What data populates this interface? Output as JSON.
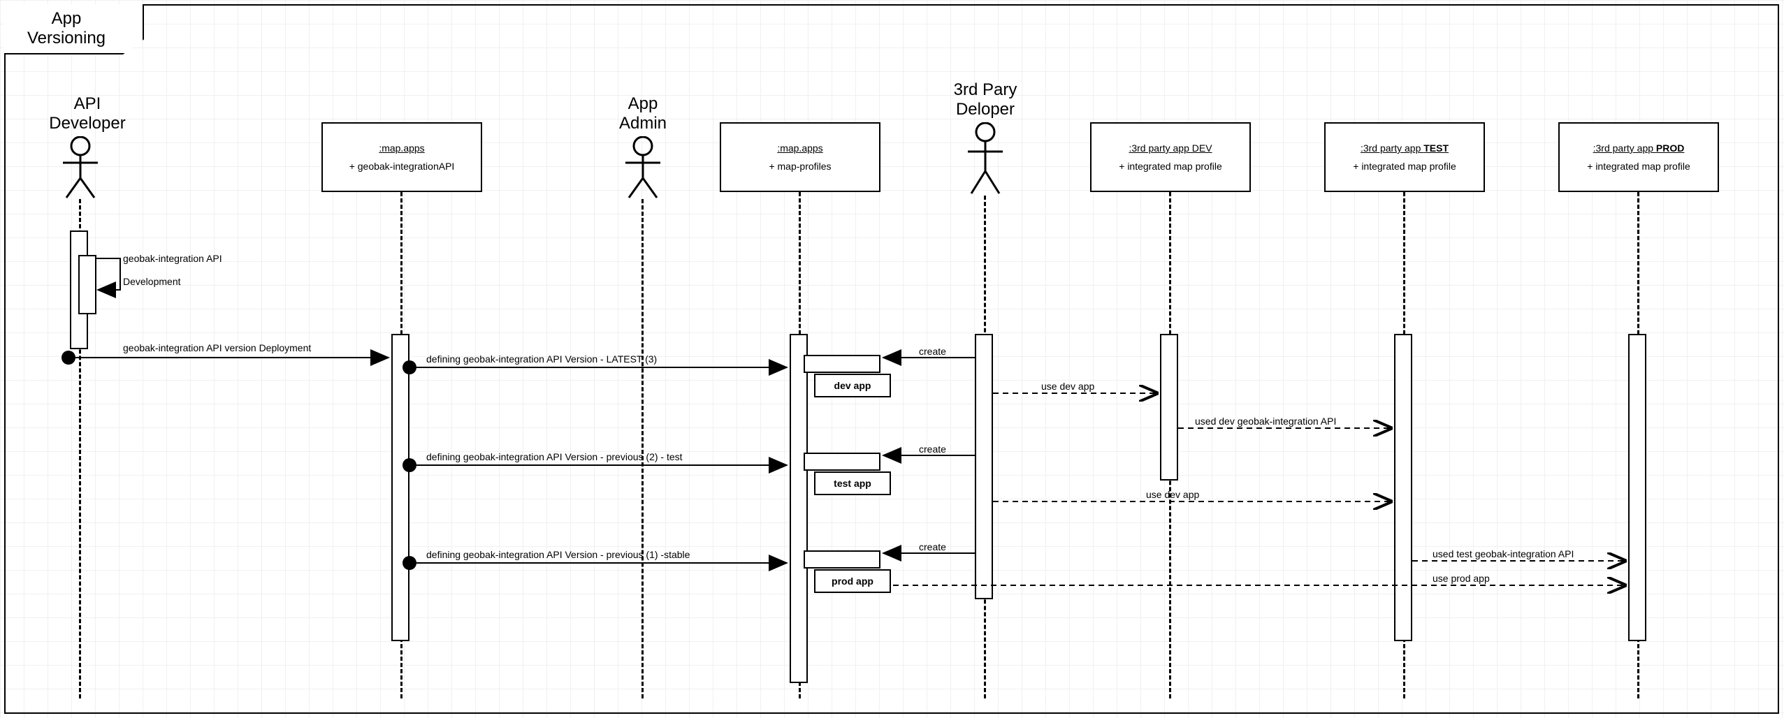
{
  "frame": {
    "title": "App\nVersioning"
  },
  "actors": {
    "api_dev": "API\nDeveloper",
    "app_admin": "App\nAdmin",
    "third_party": "3rd Pary\nDeloper"
  },
  "objects": {
    "mapapps1": {
      "title": ":map.apps",
      "sub": "+ geobak-integrationAPI"
    },
    "mapapps2": {
      "title": ":map.apps",
      "sub": "+ map-profiles"
    },
    "dev": {
      "title": ":3rd party app DEV",
      "sub": "+ integrated map profile"
    },
    "test": {
      "title_pre": ":3rd party app ",
      "title_bold": "TEST",
      "sub": "+ integrated map profile"
    },
    "prod": {
      "title_pre": ":3rd party app ",
      "title_bold": "PROD",
      "sub": "+ integrated map profile"
    }
  },
  "note": {
    "line1": "geobak-integration API",
    "line2": "Development"
  },
  "messages": {
    "deploy": "geobak-integration API version Deployment",
    "def_latest": "defining geobak-integration API Version - LATEST (3)",
    "def_prev_test": "defining geobak-integration API Version - previous (2) - test",
    "def_prev_stable": "defining geobak-integration API Version - previous (1) -stable",
    "create": "create",
    "use_dev": "use dev app",
    "use_dev2": "use dev app",
    "use_prod": "use prod app",
    "used_dev": "used dev geobak-integration API",
    "used_test": "used test geobak-integration API"
  },
  "apps": {
    "dev": "dev app",
    "test": "test app",
    "prod": "prod app"
  }
}
